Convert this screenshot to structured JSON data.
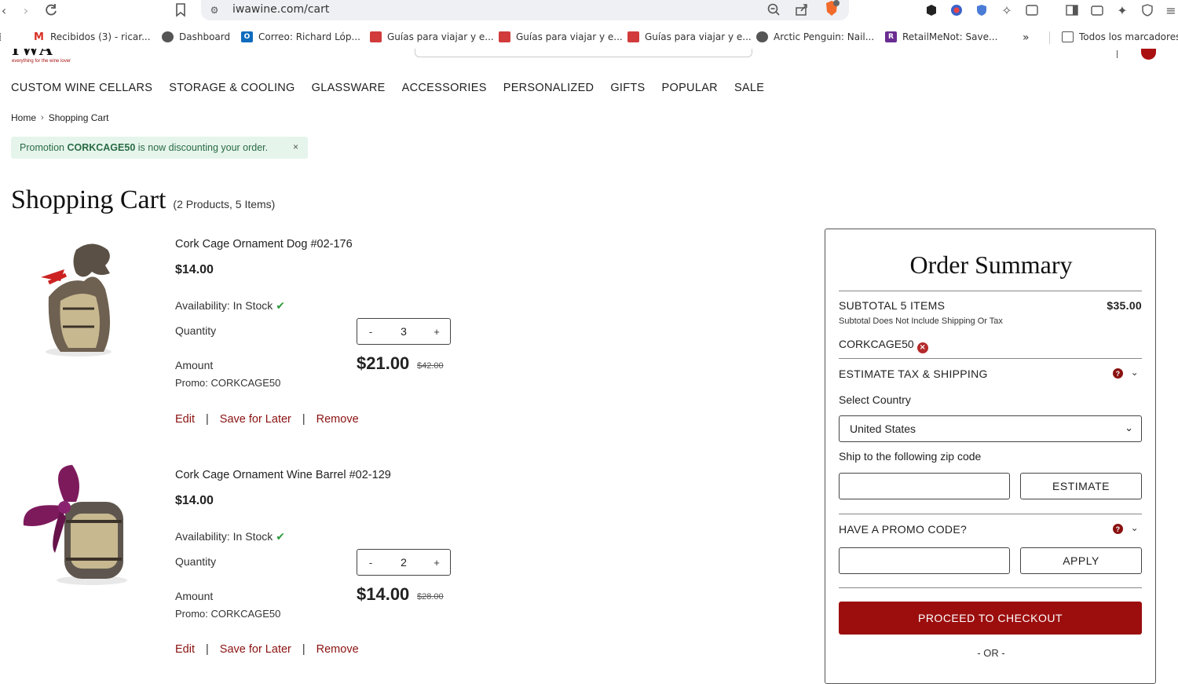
{
  "browser": {
    "url": "iwawine.com/cart",
    "bookmarks": [
      {
        "label": "Recibidos (3) - ricar...",
        "icon": "gmail-icon",
        "color": "#d93025"
      },
      {
        "label": "Dashboard",
        "icon": "globe-icon",
        "color": "#555555"
      },
      {
        "label": "Correo: Richard Lóp...",
        "icon": "outlook-icon",
        "color": "#0f6cbd"
      },
      {
        "label": "Guías para viajar y e...",
        "icon": "guide-icon",
        "color": "#d13b3b"
      },
      {
        "label": "Guías para viajar y e...",
        "icon": "guide-icon",
        "color": "#d13b3b"
      },
      {
        "label": "Guías para viajar y e...",
        "icon": "guide-icon",
        "color": "#d13b3b"
      },
      {
        "label": "Arctic Penguin: Nail...",
        "icon": "globe-icon",
        "color": "#555555"
      },
      {
        "label": "RetailMeNot: Save...",
        "icon": "retailmenot-icon",
        "color": "#6a2c91"
      }
    ],
    "all_bookmarks": "Todos los marcadores"
  },
  "nav": [
    "CUSTOM WINE CELLARS",
    "STORAGE & COOLING",
    "GLASSWARE",
    "ACCESSORIES",
    "PERSONALIZED",
    "GIFTS",
    "POPULAR",
    "SALE"
  ],
  "breadcrumb": {
    "home": "Home",
    "current": "Shopping Cart"
  },
  "promo_banner": {
    "prefix": "Promotion ",
    "code": "CORKCAGE50",
    "suffix": " is now discounting your order.",
    "close": "×"
  },
  "cart": {
    "title": "Shopping Cart",
    "count": "(2 Products, 5 Items)",
    "products": [
      {
        "name": "Cork Cage Ornament Dog #02-176",
        "price": "$14.00",
        "availability": "Availability: In Stock",
        "quantity_label": "Quantity",
        "quantity": "3",
        "amount_label": "Amount",
        "amount": "$21.00",
        "original": "$42.00",
        "promo": "Promo: CORKCAGE50",
        "edit": "Edit",
        "save": "Save for Later",
        "remove": "Remove"
      },
      {
        "name": "Cork Cage Ornament Wine Barrel #02-129",
        "price": "$14.00",
        "availability": "Availability: In Stock",
        "quantity_label": "Quantity",
        "quantity": "2",
        "amount_label": "Amount",
        "amount": "$14.00",
        "original": "$28.00",
        "promo": "Promo: CORKCAGE50",
        "edit": "Edit",
        "save": "Save for Later",
        "remove": "Remove"
      }
    ]
  },
  "summary": {
    "title": "Order Summary",
    "subtotal_label": "SUBTOTAL 5 ITEMS",
    "subtotal_value": "$35.00",
    "subtotal_note": "Subtotal Does Not Include Shipping Or Tax",
    "applied_code": "CORKCAGE50",
    "estimate_heading": "ESTIMATE TAX & SHIPPING",
    "country_label": "Select Country",
    "country_value": "United States",
    "zip_label": "Ship to the following zip code",
    "estimate_button": "ESTIMATE",
    "promo_heading": "HAVE A PROMO CODE?",
    "apply_button": "APPLY",
    "checkout_button": "PROCEED TO CHECKOUT",
    "or": "- OR -"
  },
  "colors": {
    "accent": "#9c0e0e",
    "link": "#8b1111",
    "success": "#2e9b3e",
    "banner_bg": "#e6f5ec"
  }
}
